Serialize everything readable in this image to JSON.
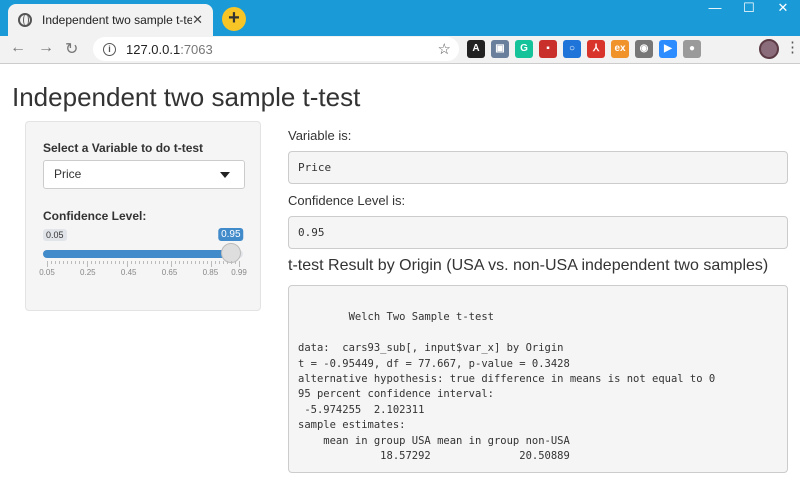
{
  "browser": {
    "tab_title": "Independent two sample t-test",
    "tab_close": "✕",
    "new_tab": "+",
    "url_host": "127.0.0.1",
    "url_port": ":7063",
    "window_controls": {
      "minimize": "—",
      "maximize": "☐",
      "close": "✕"
    },
    "extensions": [
      {
        "icon": "a-extension-icon",
        "color": "#222222",
        "glyph": "A"
      },
      {
        "icon": "image-extension-icon",
        "color": "#6a7f9c",
        "glyph": "▣"
      },
      {
        "icon": "grammarly-icon",
        "color": "#15c39a",
        "glyph": "G"
      },
      {
        "icon": "screen-capture-icon",
        "color": "#c9302c",
        "glyph": "▪"
      },
      {
        "icon": "circle-extension-icon",
        "color": "#1e74d8",
        "glyph": "○"
      },
      {
        "icon": "pdf-icon",
        "color": "#d9342b",
        "glyph": "⅄"
      },
      {
        "icon": "ex-extension-icon",
        "color": "#f0932b",
        "glyph": "ex"
      },
      {
        "icon": "record-icon",
        "color": "#777777",
        "glyph": "◉"
      },
      {
        "icon": "zoom-icon",
        "color": "#2d8cff",
        "glyph": "▶"
      },
      {
        "icon": "globe-extension-icon",
        "color": "#9a9a9a",
        "glyph": "●"
      }
    ]
  },
  "page": {
    "title": "Independent two sample t-test"
  },
  "sidebar": {
    "variable_label": "Select a Variable to do t-test",
    "variable_selected": "Price",
    "confidence_label": "Confidence Level:",
    "slider": {
      "min": 0.05,
      "max": 0.99,
      "value": 0.95,
      "min_label": "0.05",
      "value_label": "0.95",
      "tick_labels": [
        "0.05",
        "0.25",
        "0.45",
        "0.65",
        "0.85",
        "0.99"
      ],
      "tick_values": [
        0.05,
        0.25,
        0.45,
        0.65,
        0.85,
        0.99
      ]
    }
  },
  "main": {
    "variable_is_label": "Variable is:",
    "variable_is_value": "Price",
    "confidence_is_label": "Confidence Level is:",
    "confidence_is_value": "0.95",
    "result_title": "t-test Result by Origin (USA vs. non-USA independent two samples)",
    "result_text": "\n\tWelch Two Sample t-test\n\ndata:  cars93_sub[, input$var_x] by Origin\nt = -0.95449, df = 77.667, p-value = 0.3428\nalternative hypothesis: true difference in means is not equal to 0\n95 percent confidence interval:\n -5.974255  2.102311\nsample estimates:\n    mean in group USA mean in group non-USA\n             18.57292              20.50889"
  },
  "colors": {
    "chrome_bar": "#1a9ad6",
    "slider_accent": "#428bca",
    "new_tab_button": "#f7c525"
  }
}
